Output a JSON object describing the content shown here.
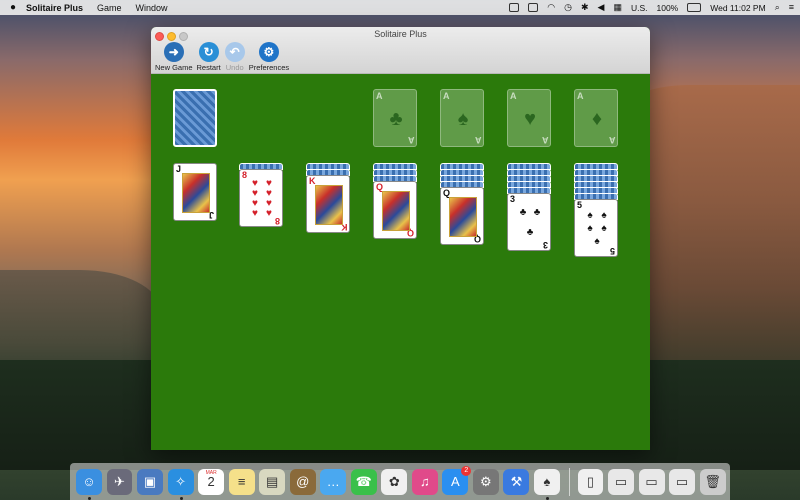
{
  "menubar": {
    "apple": "",
    "app_name": "Solitaire Plus",
    "menus": [
      "Game",
      "Window"
    ],
    "input_source": "U.S.",
    "battery": "100%",
    "clock": "Wed 11:02 PM"
  },
  "window": {
    "title": "Solitaire Plus",
    "toolbar": [
      {
        "label": "New Game",
        "icon": "arrow-right-icon",
        "color": "#2a6fb6"
      },
      {
        "label": "Restart",
        "icon": "restart-icon",
        "color": "#2a8fd6"
      },
      {
        "label": "Undo",
        "icon": "undo-icon",
        "color": "#8ab8e6",
        "disabled": true
      },
      {
        "label": "Preferences",
        "icon": "gear-icon",
        "color": "#1f74c8"
      }
    ]
  },
  "table": {
    "felt_color": "#2b7a0b",
    "stock": "card-back",
    "foundations": [
      {
        "rank": "A",
        "suit": "♣"
      },
      {
        "rank": "A",
        "suit": "♠"
      },
      {
        "rank": "A",
        "suit": "♥"
      },
      {
        "rank": "A",
        "suit": "♦"
      }
    ],
    "tableau": [
      {
        "hidden": 0,
        "rank": "J",
        "suit": "♣",
        "color": "black",
        "face": true
      },
      {
        "hidden": 1,
        "rank": "8",
        "suit": "♥",
        "color": "red",
        "face": false
      },
      {
        "hidden": 2,
        "rank": "K",
        "suit": "♥",
        "color": "red",
        "face": true
      },
      {
        "hidden": 3,
        "rank": "Q",
        "suit": "♦",
        "color": "red",
        "face": true
      },
      {
        "hidden": 4,
        "rank": "Q",
        "suit": "♠",
        "color": "black",
        "face": true
      },
      {
        "hidden": 5,
        "rank": "3",
        "suit": "♣",
        "color": "black",
        "face": false
      },
      {
        "hidden": 6,
        "rank": "5",
        "suit": "♠",
        "color": "black",
        "face": false
      }
    ]
  },
  "dock": {
    "items": [
      {
        "name": "finder",
        "color": "#3a8fe0",
        "glyph": "☺",
        "running": true
      },
      {
        "name": "launchpad",
        "color": "#6a6a7a",
        "glyph": "✈"
      },
      {
        "name": "photo",
        "color": "#4a7ac0",
        "glyph": "▣"
      },
      {
        "name": "safari",
        "color": "#2a8fe0",
        "glyph": "✧",
        "running": true
      },
      {
        "name": "calendar",
        "color": "#ffffff",
        "glyph": "2",
        "label": "MAR"
      },
      {
        "name": "notes",
        "color": "#f5e08a",
        "glyph": "≡"
      },
      {
        "name": "preview",
        "color": "#d8d8c0",
        "glyph": "▤"
      },
      {
        "name": "contacts",
        "color": "#8a6a3a",
        "glyph": "@"
      },
      {
        "name": "messages",
        "color": "#4aa8f0",
        "glyph": "…"
      },
      {
        "name": "facetime",
        "color": "#3ac04a",
        "glyph": "☎"
      },
      {
        "name": "photos",
        "color": "#f0f0f0",
        "glyph": "✿"
      },
      {
        "name": "itunes",
        "color": "#e04a8a",
        "glyph": "♫"
      },
      {
        "name": "app-store",
        "color": "#2a8ff0",
        "glyph": "A",
        "badge": "2"
      },
      {
        "name": "system-preferences",
        "color": "#777777",
        "glyph": "⚙"
      },
      {
        "name": "xcode",
        "color": "#3a7ae0",
        "glyph": "⚒"
      },
      {
        "name": "solitaire-plus",
        "color": "#f0f0f0",
        "glyph": "♠",
        "running": true
      },
      {
        "name": "document",
        "color": "#f0f0f0",
        "glyph": "▯"
      },
      {
        "name": "stack-1",
        "color": "#e8e8e8",
        "glyph": "▭"
      },
      {
        "name": "stack-2",
        "color": "#e8e8e8",
        "glyph": "▭"
      },
      {
        "name": "stack-3",
        "color": "#e8e8e8",
        "glyph": "▭"
      },
      {
        "name": "trash",
        "color": "#cccccc",
        "glyph": "🗑"
      }
    ]
  }
}
